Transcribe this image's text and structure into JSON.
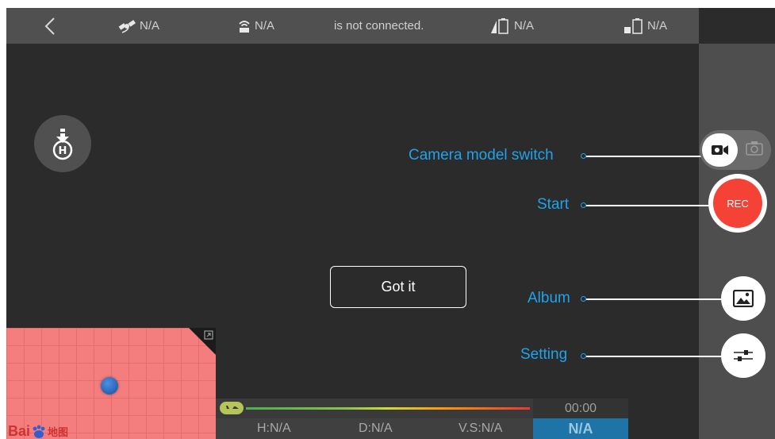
{
  "status_bar": {
    "gps": "N/A",
    "signal": "N/A",
    "connection": "is not connected.",
    "aircraft_battery": "N/A",
    "remote_battery": "N/A"
  },
  "callouts": {
    "camera_switch": "Camera model switch",
    "start": "Start",
    "album": "Album",
    "setting": "Setting"
  },
  "got_it": "Got it",
  "rec_label": "REC",
  "map": {
    "logo_text": "Bai",
    "logo_text2": "地图"
  },
  "telemetry": {
    "timer": "00:00",
    "height": "H:N/A",
    "distance": "D:N/A",
    "vertical_speed": "V.S:N/A",
    "mode": "N/A"
  },
  "colors": {
    "accent": "#1fa3ea",
    "rec": "#f44336",
    "mode_bg": "#1f74a7"
  }
}
